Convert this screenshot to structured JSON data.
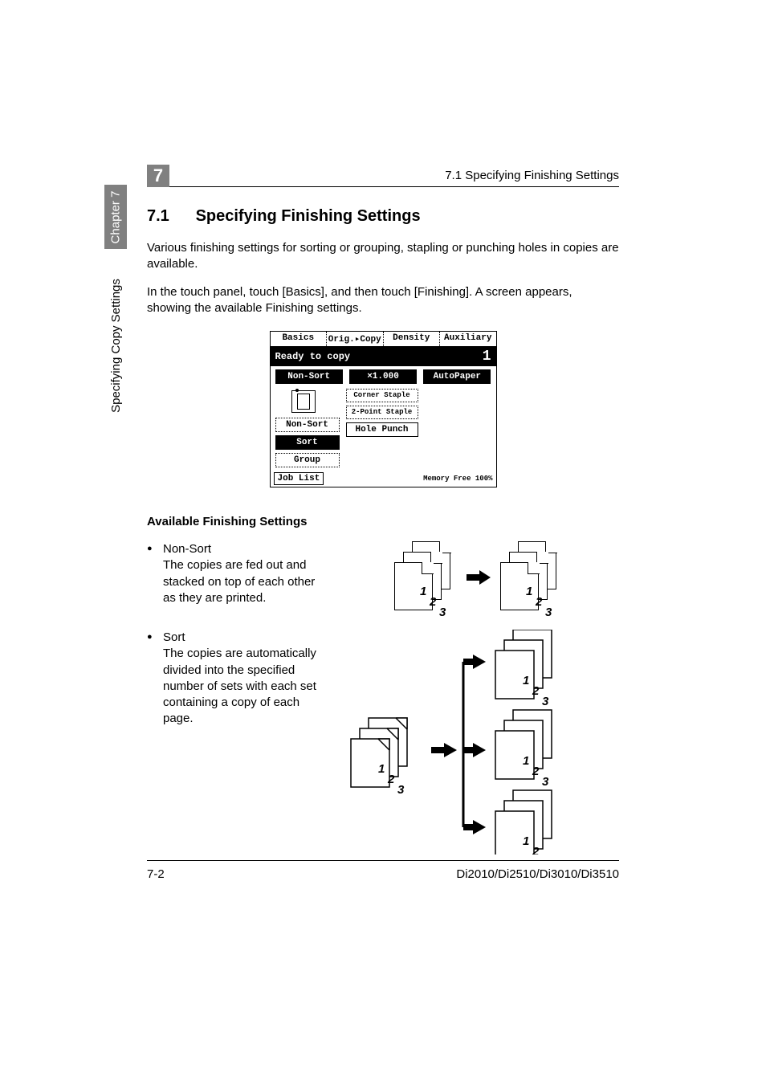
{
  "sidebar": {
    "chapter_label": "Chapter 7",
    "section_label": "Specifying Copy Settings"
  },
  "header": {
    "chapter_num": "7",
    "running_title": "7.1 Specifying Finishing Settings"
  },
  "section": {
    "number": "7.1",
    "title": "Specifying Finishing Settings",
    "intro1": "Various finishing settings for sorting or grouping, stapling or punching holes in copies are available.",
    "intro2": "In the touch panel, touch [Basics], and then touch [Finishing]. A screen appears, showing the available Finishing settings."
  },
  "panel": {
    "tabs": [
      "Basics",
      "Orig.▸Copy",
      "Density",
      "Auxiliary"
    ],
    "status": "Ready to copy",
    "count": "1",
    "row3": {
      "left": "Non-Sort",
      "mid": "×1.000",
      "right": "AutoPaper"
    },
    "left_buttons": [
      "Non-Sort",
      "Sort",
      "Group"
    ],
    "right_buttons": [
      "Corner Staple",
      "2-Point Staple",
      "Hole Punch"
    ],
    "joblist": "Job List",
    "mem_label": "Memory Free",
    "mem_value": "100%"
  },
  "available": {
    "heading": "Available Finishing Settings",
    "items": [
      {
        "name": "Non-Sort",
        "desc": "The copies are fed out and stacked on top of each other as they are printed."
      },
      {
        "name": "Sort",
        "desc": "The copies are automatically divided into the specified number of sets with each set containing a copy of each page."
      }
    ],
    "page_numbers": [
      "1",
      "2",
      "3"
    ]
  },
  "footer": {
    "page": "7-2",
    "models": "Di2010/Di2510/Di3010/Di3510"
  }
}
